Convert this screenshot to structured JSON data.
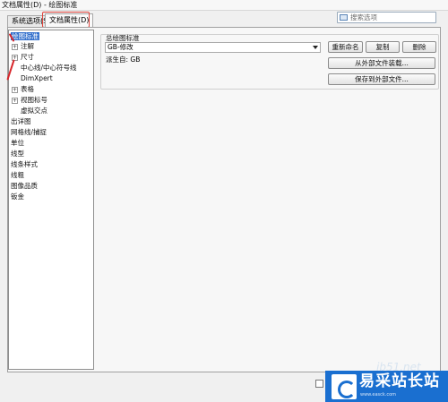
{
  "window": {
    "title": "文档属性(D) - 绘图标准"
  },
  "tabs": [
    {
      "label": "系统选项(S)"
    },
    {
      "label": "文档属性(D)"
    }
  ],
  "search": {
    "placeholder": "搜索选项"
  },
  "tree": {
    "items": [
      {
        "label": "绘图标准",
        "selected": true
      },
      {
        "label": "注解",
        "expandable": true
      },
      {
        "label": "尺寸",
        "expandable": true
      },
      {
        "label": "中心线/中心符号线"
      },
      {
        "label": "DimXpert"
      },
      {
        "label": "表格",
        "expandable": true
      },
      {
        "label": "视图标号",
        "expandable": true
      },
      {
        "label": "虚拟交点"
      },
      {
        "label": "出详图"
      },
      {
        "label": "网格线/捕捉"
      },
      {
        "label": "单位"
      },
      {
        "label": "线型"
      },
      {
        "label": "线条样式"
      },
      {
        "label": "线粗"
      },
      {
        "label": "图像品质"
      },
      {
        "label": "钣金"
      }
    ]
  },
  "standard": {
    "group_title": "总绘图标准",
    "selected_value": "GB-修改",
    "derived_from": "派生自: GB",
    "buttons": {
      "rename": "重新命名",
      "copy": "复制",
      "delete": "删除",
      "load_external": "从外部文件装载...",
      "save_external": "保存到外部文件..."
    }
  },
  "watermark": {
    "url_top": "jb51.net",
    "brand": "易采站长站",
    "sub": "www.easck.com"
  },
  "colors": {
    "selection": "#3370cc",
    "highlight_red": "#e0443c",
    "watermark_blue": "#1a6fd0"
  }
}
